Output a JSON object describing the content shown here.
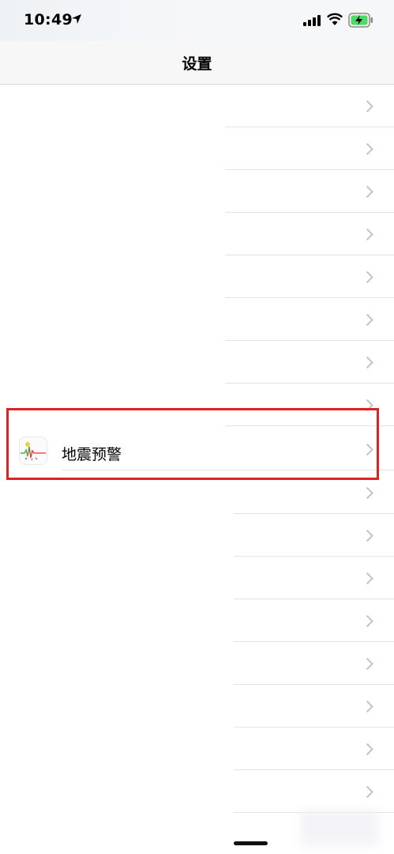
{
  "status_bar": {
    "time": "10:49",
    "location_icon": "location-arrow-icon",
    "signal_icon": "cellular-signal-icon",
    "wifi_icon": "wifi-icon",
    "battery_icon": "battery-charging-icon",
    "battery_color": "#4cd964"
  },
  "nav": {
    "title": "设置"
  },
  "settings": {
    "rows": [
      {
        "label": ""
      },
      {
        "label": ""
      },
      {
        "label": ""
      },
      {
        "label": ""
      },
      {
        "label": ""
      },
      {
        "label": ""
      },
      {
        "label": ""
      },
      {
        "label": ""
      },
      {
        "label": "地震预警",
        "icon": "earthquake-warning-app-icon",
        "highlighted": true
      },
      {
        "label": ""
      },
      {
        "label": ""
      },
      {
        "label": ""
      },
      {
        "label": ""
      },
      {
        "label": ""
      },
      {
        "label": ""
      },
      {
        "label": ""
      },
      {
        "label": ""
      }
    ]
  },
  "highlight": {
    "color": "#e02121"
  }
}
